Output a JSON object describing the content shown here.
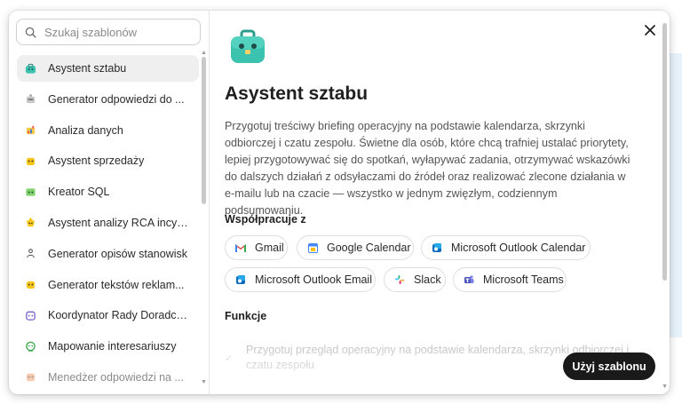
{
  "search": {
    "placeholder": "Szukaj szablonów"
  },
  "sidebar": {
    "items": [
      {
        "label": "Asystent sztabu",
        "icon": "briefcase-teal-icon",
        "active": true
      },
      {
        "label": "Generator odpowiedzi do ...",
        "icon": "robot-gray-icon"
      },
      {
        "label": "Analiza danych",
        "icon": "chart-colorful-icon"
      },
      {
        "label": "Asystent sprzedaży",
        "icon": "bot-yellow-icon"
      },
      {
        "label": "Kreator SQL",
        "icon": "bot-green-icon"
      },
      {
        "label": "Asystent analizy RCA incyd...",
        "icon": "bot-yellow-flame-icon"
      },
      {
        "label": "Generator opisów stanowisk",
        "icon": "person-outline-icon"
      },
      {
        "label": "Generator tekstów reklam...",
        "icon": "bot-yellow-small-icon"
      },
      {
        "label": "Koordynator Rady Doradcz...",
        "icon": "bot-purple-icon"
      },
      {
        "label": "Mapowanie interesariuszy",
        "icon": "bot-green-face-icon"
      },
      {
        "label": "Menedżer odpowiedzi na ...",
        "icon": "bot-orange-icon"
      }
    ]
  },
  "detail": {
    "title": "Asystent sztabu",
    "description": "Przygotuj treściwy briefing operacyjny na podstawie kalendarza, skrzynki odbiorczej i czatu zespołu. Świetne dla osób, które chcą trafniej ustalać priorytety, lepiej przygotowywać się do spotkań, wyłapywać zadania, otrzymywać wskazówki do dalszych działań z odsyłaczami do źródeł oraz realizować zlecone działania w e-mailu lub na czacie — wszystko w jednym zwięzłym, codziennym podsumowaniu.",
    "integrations_title": "Współpracuje z",
    "integrations": [
      {
        "label": "Gmail",
        "icon": "gmail-icon"
      },
      {
        "label": "Google Calendar",
        "icon": "google-calendar-icon"
      },
      {
        "label": "Microsoft Outlook Calendar",
        "icon": "outlook-icon"
      },
      {
        "label": "Microsoft Outlook Email",
        "icon": "outlook-icon"
      },
      {
        "label": "Slack",
        "icon": "slack-icon"
      },
      {
        "label": "Microsoft Teams",
        "icon": "teams-icon"
      }
    ],
    "features_title": "Funkcje",
    "features": [
      "Przygotuj przegląd operacyjny na podstawie kalendarza, skrzynki odbiorczej i czatu zespołu"
    ],
    "use_button": "Użyj szablonu"
  },
  "colors": {
    "accent_teal": "#3cc3b0",
    "button_dark": "#1a1a1a",
    "active_item_bg": "#efefef"
  }
}
